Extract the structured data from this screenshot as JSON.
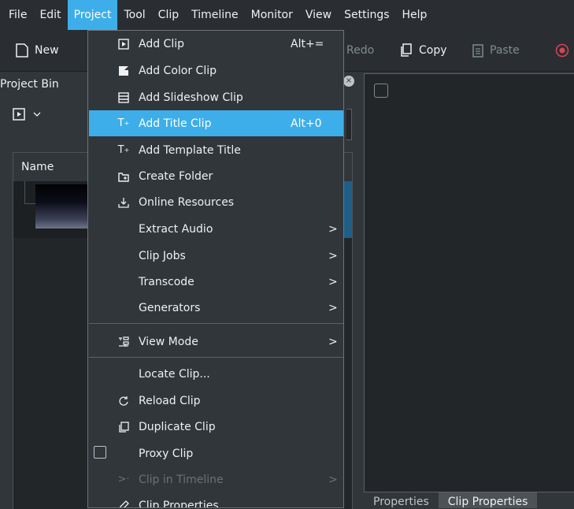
{
  "menubar": {
    "items": [
      {
        "label": "File"
      },
      {
        "label": "Edit"
      },
      {
        "label": "Project",
        "active": true
      },
      {
        "label": "Tool"
      },
      {
        "label": "Clip"
      },
      {
        "label": "Timeline"
      },
      {
        "label": "Monitor"
      },
      {
        "label": "View"
      },
      {
        "label": "Settings"
      },
      {
        "label": "Help"
      }
    ]
  },
  "toolbar": {
    "new_label": "New",
    "redo_label": "Redo",
    "copy_label": "Copy",
    "paste_label": "Paste"
  },
  "project_bin": {
    "title": "Project Bin",
    "column_name": "Name"
  },
  "bottom_tabs": [
    "Properties",
    "Clip Properties"
  ],
  "project_menu": {
    "items": [
      {
        "icon": "add-clip-icon",
        "label": "Add Clip",
        "shortcut": "Alt+="
      },
      {
        "icon": "color-clip-icon",
        "label": "Add Color Clip"
      },
      {
        "icon": "slideshow-icon",
        "label": "Add Slideshow Clip"
      },
      {
        "icon": "title-icon",
        "label": "Add Title Clip",
        "shortcut": "Alt+0",
        "active": true
      },
      {
        "icon": "template-title-icon",
        "label": "Add Template Title"
      },
      {
        "icon": "folder-icon",
        "label": "Create Folder"
      },
      {
        "icon": "download-icon",
        "label": "Online Resources"
      },
      {
        "label": "Extract Audio",
        "submenu": true
      },
      {
        "label": "Clip Jobs",
        "submenu": true
      },
      {
        "label": "Transcode",
        "submenu": true
      },
      {
        "label": "Generators",
        "submenu": true
      },
      {
        "icon": "view-mode-icon",
        "label": "View Mode",
        "submenu": true
      },
      {
        "label": "Locate Clip..."
      },
      {
        "icon": "reload-icon",
        "label": "Reload Clip"
      },
      {
        "icon": "duplicate-icon",
        "label": "Duplicate Clip"
      },
      {
        "label": "Proxy Clip",
        "checkbox": true
      },
      {
        "icon": "clip-in-timeline-icon",
        "label": "Clip in Timeline",
        "submenu": true,
        "disabled": true
      },
      {
        "icon": "properties-icon",
        "label": "Clip Properties"
      }
    ]
  },
  "colors": {
    "accent": "#3daee9",
    "background": "#31363b",
    "menubar": "#2a2e32",
    "record": "#da4453"
  }
}
